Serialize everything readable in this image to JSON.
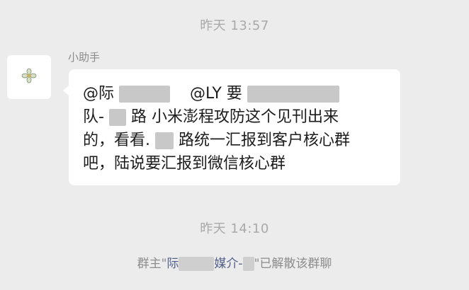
{
  "chat": {
    "timestamp_1": "昨天 13:57",
    "timestamp_2": "昨天 14:10",
    "sender_name": "小助手",
    "avatar_icon": "flower-icon",
    "message": {
      "line1_a": "@际",
      "line1_b": "@LY",
      "line1_c": "要",
      "line2_a": "队-",
      "line2_b": "路 小米澎程攻防这个见刊出来",
      "line3_a": "的，看看.",
      "line3_b": "路统一汇报到客户核心群",
      "line4": "吧，陆说要汇报到微信核心群"
    },
    "system_notice": {
      "prefix": "群主\"",
      "name_a": "际",
      "name_b": "媒介-",
      "suffix": "\"已解散该群聊"
    }
  }
}
